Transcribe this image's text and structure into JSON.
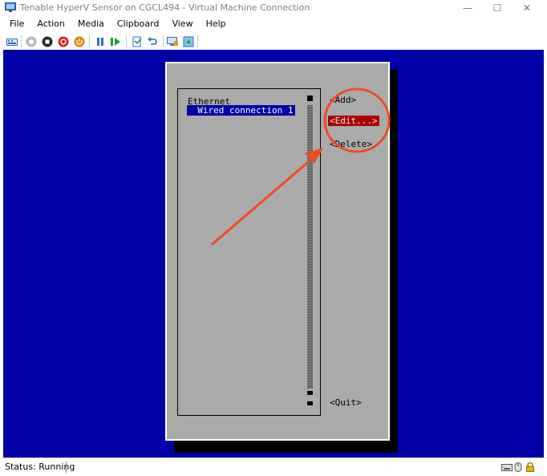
{
  "window": {
    "title": "Tenable HyperV Sensor on CGCL494 - Virtual Machine Connection",
    "minimize": "—",
    "maximize": "☐",
    "close": "✕"
  },
  "menu": [
    "File",
    "Action",
    "Media",
    "Clipboard",
    "View",
    "Help"
  ],
  "toolbar": {
    "icons": [
      "ctrl-alt-del-icon",
      "start-icon",
      "turn-off-icon",
      "shut-down-icon",
      "save-state-icon",
      "pause-icon",
      "resume-icon",
      "checkpoint-icon",
      "revert-icon",
      "enhanced-session-icon",
      "share-icon"
    ]
  },
  "nmtui": {
    "list_header": "Ethernet",
    "selected_connection": "  Wired connection 1 ",
    "buttons": {
      "add": "<Add>",
      "edit": "<Edit...>",
      "delete": "<Delete>",
      "quit": "<Quit>"
    }
  },
  "colors": {
    "console_background": "#0000a8",
    "dialog_background": "#aaaaaa",
    "selected_button": "#aa0000",
    "annotation": "#f04a23"
  },
  "status": {
    "text": "Status: Running"
  }
}
